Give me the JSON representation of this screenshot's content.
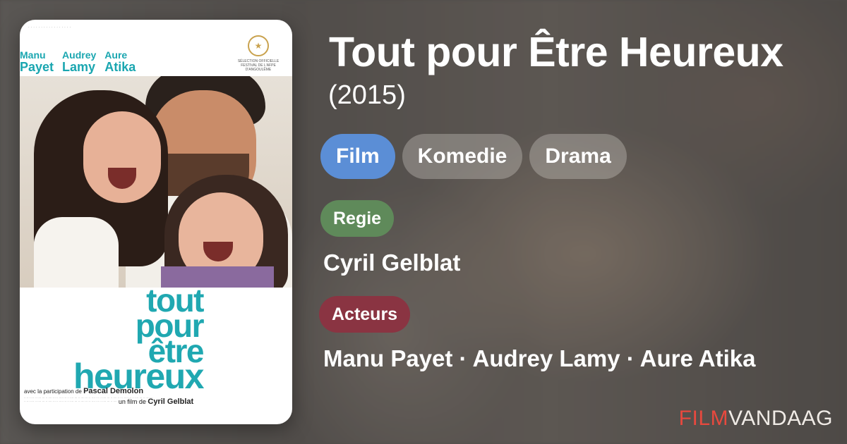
{
  "movie": {
    "title": "Tout pour Être Heureux",
    "year": "(2015)",
    "type_tag": "Film",
    "genres": [
      "Komedie",
      "Drama"
    ],
    "director_label": "Regie",
    "director": "Cyril Gelblat",
    "actors_label": "Acteurs",
    "actors": "Manu Payet · Audrey Lamy · Aure Atika"
  },
  "poster": {
    "cast": [
      {
        "first": "Manu",
        "last": "Payet"
      },
      {
        "first": "Audrey",
        "last": "Lamy"
      },
      {
        "first": "Aure",
        "last": "Atika"
      }
    ],
    "title_lines": [
      "tout",
      "pour",
      "être",
      "heureux"
    ],
    "avec_prefix": "avec la participation de",
    "avec_name": "Pascal Demolon",
    "director_prefix": "un film de",
    "director_name": "Cyril Gelblat",
    "laurel_text": "SÉLECTION OFFICIELLE FESTIVAL DE L'AFPE D'ANGOULÊME"
  },
  "brand": {
    "part1": "FILM",
    "part2": "VANDAAG"
  },
  "colors": {
    "type_chip": "#5b8ed6",
    "regie_pill": "#5f8a5a",
    "acteurs_pill": "#8a3442",
    "brand_red": "#e8493e",
    "poster_teal": "#20a8b1"
  }
}
